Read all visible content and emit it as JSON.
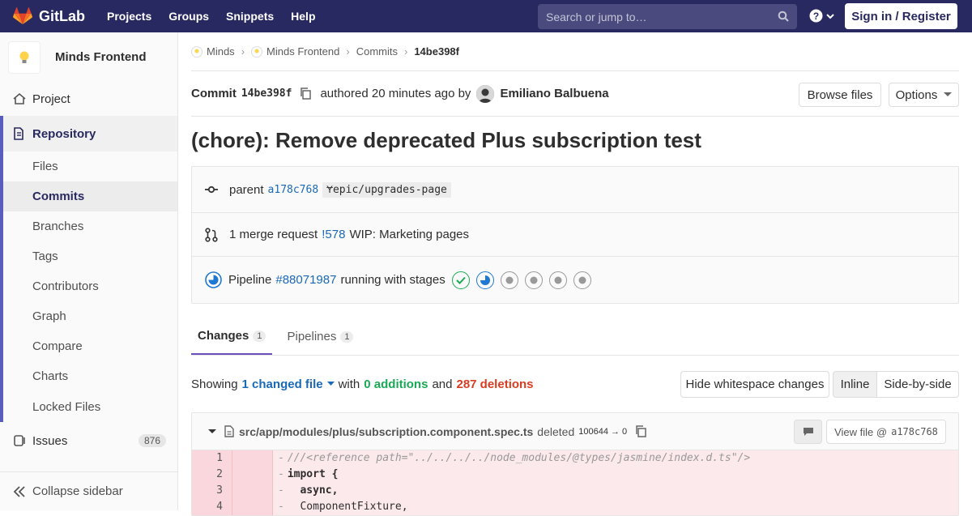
{
  "navbar": {
    "brand": "GitLab",
    "links": [
      "Projects",
      "Groups",
      "Snippets",
      "Help"
    ],
    "search_placeholder": "Search or jump to…",
    "signin": "Sign in / Register"
  },
  "sidebar": {
    "project_name": "Minds Frontend",
    "project": "Project",
    "repository": "Repository",
    "repo_items": [
      "Files",
      "Commits",
      "Branches",
      "Tags",
      "Contributors",
      "Graph",
      "Compare",
      "Charts",
      "Locked Files"
    ],
    "issues": "Issues",
    "issues_count": "876",
    "collapse": "Collapse sidebar"
  },
  "breadcrumb": {
    "items": [
      "Minds",
      "Minds Frontend",
      "Commits"
    ],
    "current": "14be398f"
  },
  "commit": {
    "label": "Commit",
    "sha": "14be398f",
    "authored": "authored 20 minutes ago by",
    "author": "Emiliano Balbuena",
    "browse_files": "Browse files",
    "options": "Options",
    "title": "(chore): Remove deprecated Plus subscription test"
  },
  "info": {
    "parent_label": "parent",
    "parent_sha": "a178c768",
    "branch": "epic/upgrades-page",
    "mr_text": "1 merge request",
    "mr_id": "!578",
    "mr_title": "WIP: Marketing pages",
    "pipeline_label": "Pipeline",
    "pipeline_id": "#88071987",
    "pipeline_status": "running with stages"
  },
  "tabs": {
    "changes": "Changes",
    "changes_count": "1",
    "pipelines": "Pipelines",
    "pipelines_count": "1"
  },
  "diff_summary": {
    "showing": "Showing",
    "changed": "1 changed file",
    "with": "with",
    "additions": "0 additions",
    "and": "and",
    "deletions": "287 deletions",
    "hide_ws": "Hide whitespace changes",
    "inline": "Inline",
    "side_by_side": "Side-by-side"
  },
  "file": {
    "path": "src/app/modules/plus/subscription.component.spec.ts",
    "status": "deleted",
    "mode": "100644 → 0",
    "view_prefix": "View file @",
    "view_sha": "a178c768"
  },
  "code_lines": [
    {
      "num": "1",
      "text": "///<reference path=\"../../../../node_modules/@types/jasmine/index.d.ts\"/>"
    },
    {
      "num": "2",
      "text": "import {"
    },
    {
      "num": "3",
      "text": "  async,"
    },
    {
      "num": "4",
      "text": "  ComponentFixture,"
    }
  ],
  "colors": {
    "navbar": "#292961",
    "accent": "#6b4fbb",
    "link": "#1b69b6",
    "deleted_bg": "#fbe9eb",
    "success": "#1aaa55",
    "danger": "#db3b21"
  }
}
